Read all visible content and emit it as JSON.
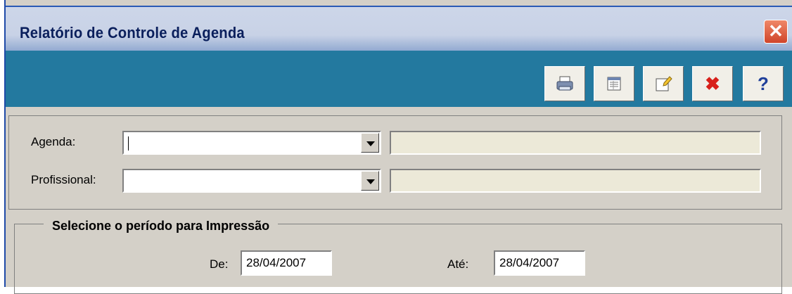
{
  "window": {
    "title": "Relatório de Controle de Agenda",
    "close_glyph": "✕"
  },
  "toolbar": {
    "buttons": [
      {
        "name": "print",
        "icon": "printer-icon"
      },
      {
        "name": "preview",
        "icon": "report-icon"
      },
      {
        "name": "edit",
        "icon": "edit-note-icon"
      },
      {
        "name": "cancel",
        "icon": "red-x-icon",
        "glyph": "✖"
      },
      {
        "name": "help",
        "icon": "question-icon",
        "glyph": "?"
      }
    ]
  },
  "filters": {
    "agenda_label": "Agenda:",
    "agenda_value": "",
    "profissional_label": "Profissional:",
    "profissional_value": ""
  },
  "period": {
    "legend": "Selecione o período para Impressão",
    "from_label": "De:",
    "from_value": "28/04/2007",
    "to_label": "Até:",
    "to_value": "28/04/2007"
  },
  "colors": {
    "toolbar": "#23799f",
    "frame": "#d4d0c8",
    "close": "#d0452a"
  }
}
